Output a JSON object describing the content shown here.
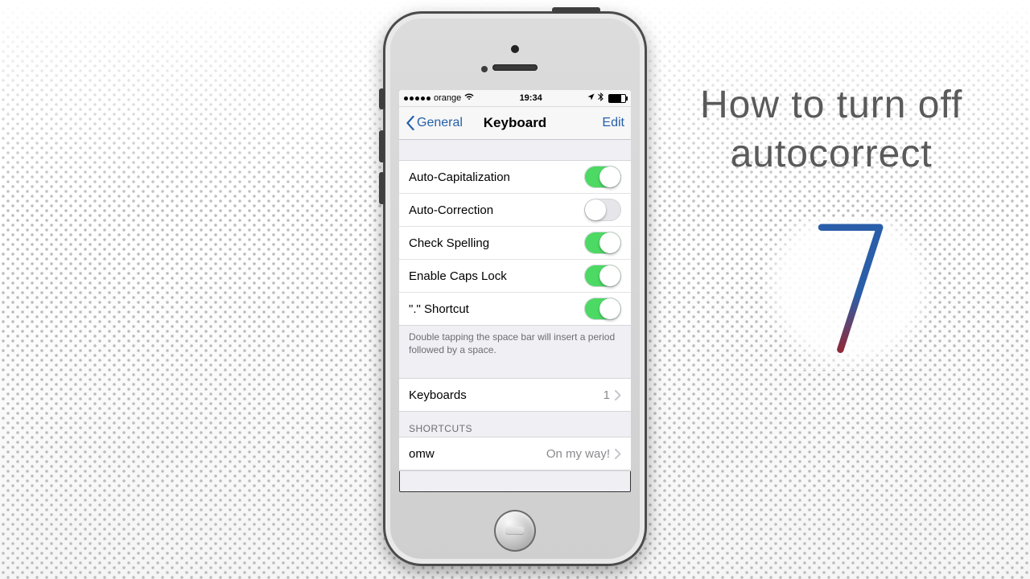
{
  "caption": {
    "line1": "How to turn off",
    "line2": "autocorrect"
  },
  "status": {
    "carrier": "orange",
    "time": "19:34"
  },
  "nav": {
    "back": "General",
    "title": "Keyboard",
    "edit": "Edit"
  },
  "toggles": [
    {
      "label": "Auto-Capitalization",
      "on": true
    },
    {
      "label": "Auto-Correction",
      "on": false
    },
    {
      "label": "Check Spelling",
      "on": true
    },
    {
      "label": "Enable Caps Lock",
      "on": true
    },
    {
      "label": "\".\" Shortcut",
      "on": true
    }
  ],
  "shortcut_note": "Double tapping the space bar will insert a period followed by a space.",
  "keyboards": {
    "label": "Keyboards",
    "count": "1"
  },
  "shortcuts": {
    "header": "SHORTCUTS",
    "items": [
      {
        "key": "omw",
        "value": "On my way!"
      }
    ]
  }
}
